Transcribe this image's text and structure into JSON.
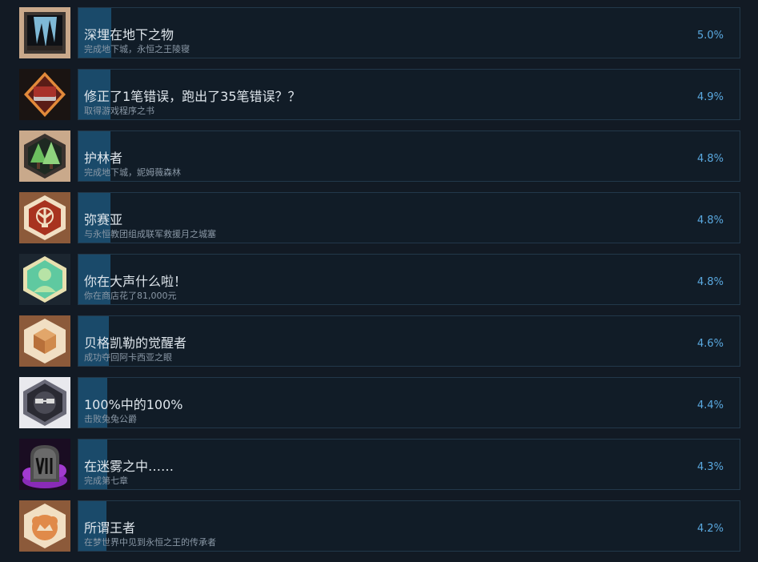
{
  "colors": {
    "background": "#121a24",
    "card_border": "#22384a",
    "progress_fill": "#1a4a6a",
    "percent_text": "#5aa9e0"
  },
  "achievements": [
    {
      "title": "深埋在地下之物",
      "description": "完成地下城，永恒之王陵寝",
      "percent": "5.0%",
      "percent_value": 5.0,
      "icon": "cave-crystal-icon"
    },
    {
      "title": "修正了1笔错误，跑出了35笔错误？？",
      "description": "取得游戏程序之书",
      "percent": "4.9%",
      "percent_value": 4.9,
      "icon": "red-book-icon"
    },
    {
      "title": "护林者",
      "description": "完成地下城，妮姆薇森林",
      "percent": "4.8%",
      "percent_value": 4.8,
      "icon": "pine-trees-icon"
    },
    {
      "title": "弥赛亚",
      "description": "与永恒教团组成联军救援月之城塞",
      "percent": "4.8%",
      "percent_value": 4.8,
      "icon": "flame-emblem-icon"
    },
    {
      "title": "你在大声什么啦！",
      "description": "你在商店花了81,000元",
      "percent": "4.8%",
      "percent_value": 4.8,
      "icon": "silhouette-icon"
    },
    {
      "title": "贝格凯勒的觉醒者",
      "description": "成功夺回阿卡西亚之眼",
      "percent": "4.6%",
      "percent_value": 4.6,
      "icon": "cube-crystal-icon"
    },
    {
      "title": "100%中的100%",
      "description": "击败兔兔公爵",
      "percent": "4.4%",
      "percent_value": 4.4,
      "icon": "sunglasses-bunny-icon"
    },
    {
      "title": "在迷雾之中……",
      "description": "完成第七章",
      "percent": "4.3%",
      "percent_value": 4.3,
      "icon": "chapter-seven-tombstone-icon"
    },
    {
      "title": "所谓王者",
      "description": "在梦世界中见到永恒之王的传承者",
      "percent": "4.2%",
      "percent_value": 4.2,
      "icon": "crowned-shield-icon"
    }
  ]
}
